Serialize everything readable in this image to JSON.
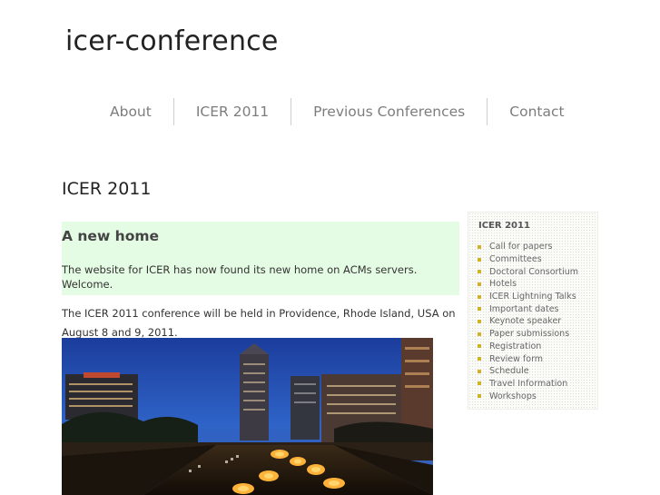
{
  "site": {
    "title": "icer-conference"
  },
  "nav": [
    {
      "label": "About"
    },
    {
      "label": "ICER 2011"
    },
    {
      "label": "Previous Conferences"
    },
    {
      "label": "Contact"
    }
  ],
  "page": {
    "title": "ICER 2011"
  },
  "main": {
    "highlight_heading": "A new home",
    "highlight_text": "The website for ICER has now found its new home on ACMs servers. Welcome.",
    "body_text": "The ICER 2011 conference will be held in Providence, Rhode Island, USA on August 8 and 9, 2011."
  },
  "sidebar": {
    "title": "ICER 2011",
    "items": [
      {
        "label": "Call for papers"
      },
      {
        "label": "Committees"
      },
      {
        "label": "Doctoral Consortium"
      },
      {
        "label": "Hotels"
      },
      {
        "label": "ICER Lightning Talks"
      },
      {
        "label": "Important dates"
      },
      {
        "label": "Keynote speaker"
      },
      {
        "label": "Paper submissions"
      },
      {
        "label": "Registration"
      },
      {
        "label": "Review form"
      },
      {
        "label": "Schedule"
      },
      {
        "label": "Travel Information"
      },
      {
        "label": "Workshops"
      }
    ]
  },
  "colors": {
    "highlight_bg": "#e4fbe4",
    "bullet": "#d2b02a",
    "nav_text": "#7d7d7d"
  }
}
